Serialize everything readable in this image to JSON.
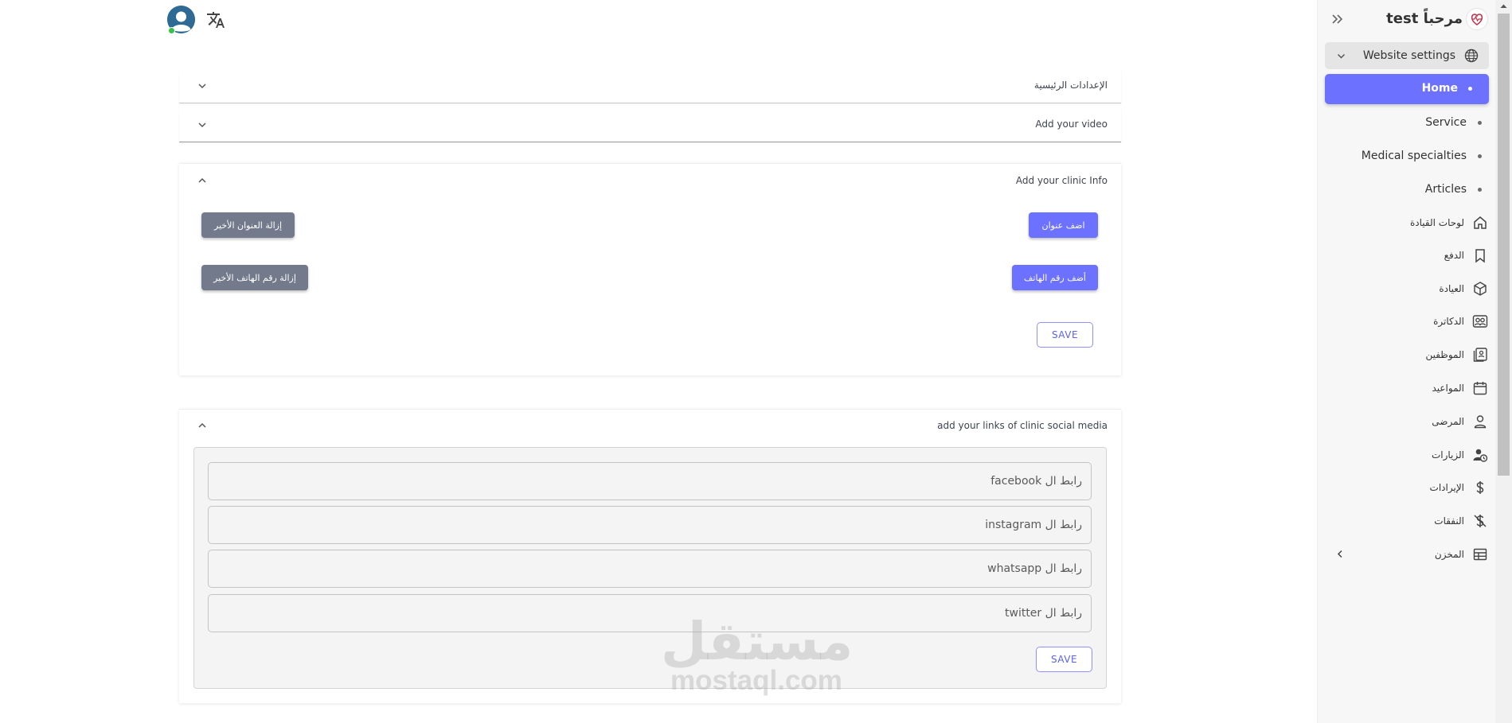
{
  "topbar": {
    "avatar_icon": "user-avatar-icon",
    "translate_icon": "translate-icon"
  },
  "sections": {
    "main_settings": {
      "title": "الإعدادات الرئيسية"
    },
    "video": {
      "title": "Add your video"
    },
    "clinic_info": {
      "title": "Add your clinic Info",
      "add_address_label": "اضف عنوان",
      "remove_address_label": "إزالة العنوان الأخير",
      "add_phone_label": "أضف رقم الهاتف",
      "remove_phone_label": "إزالة رقم الهاتف الأخير",
      "save_label": "SAVE"
    },
    "social_media": {
      "title": "add your links of clinic social media",
      "links": [
        {
          "placeholder": "رابط ال facebook"
        },
        {
          "placeholder": "رابط ال instagram"
        },
        {
          "placeholder": "رابط ال whatsapp"
        },
        {
          "placeholder": "رابط ال twitter"
        }
      ],
      "save_label": "SAVE"
    }
  },
  "watermark": {
    "arabic": "مستقل",
    "english": "mostaql.com"
  },
  "sidebar": {
    "brand": "مرحباً test",
    "group": {
      "label": "Website settings"
    },
    "sub_items": [
      {
        "label": "Home",
        "active": true
      },
      {
        "label": "Service"
      },
      {
        "label": "Medical specialties"
      },
      {
        "label": "Articles"
      }
    ],
    "nav_items": [
      {
        "label": "لوحات القيادة",
        "icon": "home-icon"
      },
      {
        "label": "الدفع",
        "icon": "bookmark-icon"
      },
      {
        "label": "العيادة",
        "icon": "cube-icon"
      },
      {
        "label": "الدكاترة",
        "icon": "users-icon"
      },
      {
        "label": "الموظفين",
        "icon": "contact-book-icon"
      },
      {
        "label": "المواعيد",
        "icon": "calendar-icon"
      },
      {
        "label": "المرضى",
        "icon": "person-icon"
      },
      {
        "label": "الزيارات",
        "icon": "user-clock-icon"
      },
      {
        "label": "الإيرادات",
        "icon": "dollar-icon"
      },
      {
        "label": "النفقات",
        "icon": "dollar-off-icon"
      },
      {
        "label": "المخزن",
        "icon": "table-icon"
      }
    ]
  },
  "colors": {
    "primary": "#6c72ff",
    "secondary": "#727a8c",
    "sidebar_bg": "#f7f7f7"
  }
}
